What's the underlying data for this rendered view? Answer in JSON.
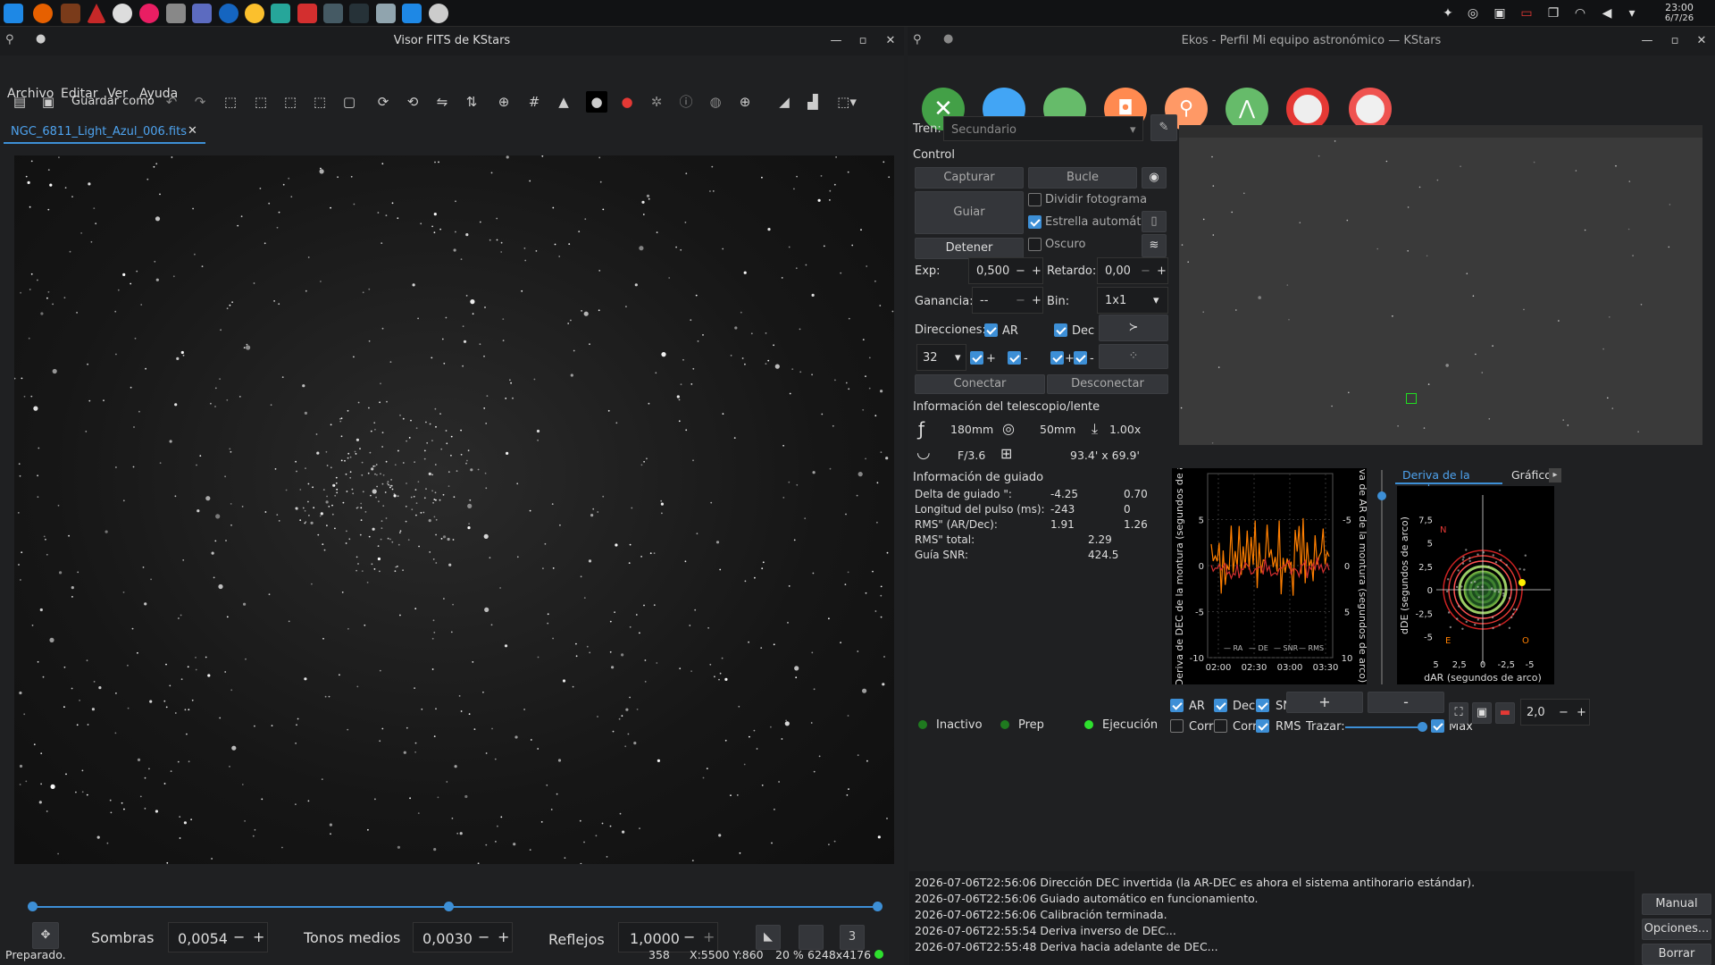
{
  "taskbar": {
    "time": "23:00",
    "date": "6/7/26"
  },
  "fits": {
    "title": "Visor FITS de KStars",
    "menu": [
      "Archivo",
      "Editar",
      "Ver",
      "Ayuda"
    ],
    "save_as": "Guardar como",
    "tab": "NGC_6811_Light_Azul_006.fits",
    "shadows_label": "Sombras",
    "shadows_value": "0,0054",
    "midtones_label": "Tonos medios",
    "midtones_value": "0,0030",
    "highlights_label": "Reflejos",
    "highlights_value": "1,0000",
    "stretch_count": "3",
    "status": "Preparado.",
    "pixel_value": "358",
    "coords": "X:5500 Y:860",
    "zoom": "20 %",
    "size": "6248x4176"
  },
  "ekos": {
    "title": "Ekos - Perfil Mi equipo astronómico — KStars",
    "train_label": "Tren:",
    "train_value": "Secundario",
    "control_label": "Control",
    "capture": "Capturar",
    "loop": "Bucle",
    "guide": "Guiar",
    "stop": "Detener",
    "subframe": "Dividir fotograma",
    "autostar": "Estrella automática",
    "dark": "Oscuro",
    "exp_label": "Exp:",
    "exp_value": "0,500",
    "delay_label": "Retardo:",
    "delay_value": "0,00",
    "gain_label": "Ganancia:",
    "gain_value": "--",
    "bin_label": "Bin:",
    "bin_value": "1x1",
    "dir_label": "Direcciones:",
    "ra": "AR",
    "dec": "Dec",
    "box_value": "32",
    "plus": "+",
    "minus": "-",
    "connect": "Conectar",
    "disconnect": "Desconectar",
    "scope_info": "Información del telescopio/lente",
    "focal": "180mm",
    "aperture": "50mm",
    "reducer": "1.00x",
    "fratio": "F/3.6",
    "fov": "93.4' x 69.9'",
    "guide_info": "Información de guiado",
    "rows": [
      {
        "label": "Delta de guiado \":",
        "a": "-4.25",
        "b": "0.70"
      },
      {
        "label": "Longitud del pulso (ms):",
        "a": "-243",
        "b": "0"
      },
      {
        "label": "RMS\" (AR/Dec):",
        "a": "1.91",
        "b": "1.26"
      },
      {
        "label": "RMS\" total:",
        "a": "",
        "b": "2.29"
      },
      {
        "label": "Guía SNR:",
        "a": "",
        "b": "424.5"
      }
    ],
    "status_idle": "Inactivo",
    "status_prep": "Prep",
    "status_run": "Ejecución",
    "graph_tabs": [
      "Deriva de la montura",
      "Gráfico"
    ],
    "graph_left_label": "Deriva de DEC de la montura (segundos de arco)",
    "graph_right_label": "Deriva de AR de la montura (segundos de arco)",
    "graph_legend": [
      "RA",
      "DE",
      "SNR",
      "RMS"
    ],
    "graph_left_ticks": [
      "5",
      "0",
      "-5",
      "-10"
    ],
    "graph_right_ticks": [
      "-5",
      "0",
      "5",
      "10"
    ],
    "graph_x_ticks": [
      "02:00",
      "02:30",
      "03:00",
      "03:30"
    ],
    "drift_ylabel": "dDE (segundos de arco)",
    "drift_xlabel": "dAR (segundos de arco)",
    "drift_y_ticks": [
      "7,5",
      "5",
      "2,5",
      "0",
      "-2,5",
      "-5"
    ],
    "drift_x_ticks": [
      "5",
      "2,5",
      "0",
      "-2,5",
      "-5"
    ],
    "drift_n": "N",
    "drift_e": "E",
    "drift_o": "O",
    "opt_ar": "AR",
    "opt_dec": "Dec",
    "opt_snr": "SNR",
    "opt_corr1": "Corr",
    "opt_corr2": "Corr",
    "opt_rms": "RMS",
    "trace": "Trazar:",
    "max": "Máx",
    "plus_btn": "+",
    "minus_btn": "-",
    "scale_value": "2,0",
    "log": [
      "2026-07-06T22:56:06 Dirección DEC invertida (la AR-DEC es ahora  el sistema antihorario estándar).",
      "2026-07-06T22:56:06 Guiado automático en funcionamiento.",
      "2026-07-06T22:56:06 Calibración terminada.",
      "2026-07-06T22:55:54 Deriva inverso de DEC...",
      "2026-07-06T22:55:48 Deriva hacia adelante de DEC..."
    ],
    "manual": "Manual",
    "options": "Opciones...",
    "clear": "Borrar"
  },
  "chart_data": [
    {
      "type": "line",
      "title": "",
      "xlabel": "",
      "ylabel": "Deriva de DEC de la montura (segundos de arco)",
      "x_ticks": [
        "02:00",
        "02:30",
        "03:00",
        "03:30"
      ],
      "ylim": [
        -10,
        5
      ],
      "series": [
        {
          "name": "RA",
          "values": [
            2,
            -1,
            3,
            -0.5,
            2.5,
            -1,
            3,
            0,
            2,
            -1
          ]
        },
        {
          "name": "DE",
          "values": [
            -0.5,
            0,
            -0.5,
            0,
            -0.5,
            0,
            -0.5,
            0,
            -0.5,
            0
          ]
        }
      ]
    },
    {
      "type": "scatter",
      "title": "",
      "xlabel": "dAR (segundos de arco)",
      "ylabel": "dDE (segundos de arco)",
      "xlim": [
        5,
        -5
      ],
      "ylim": [
        -5,
        7.5
      ],
      "series": []
    }
  ]
}
